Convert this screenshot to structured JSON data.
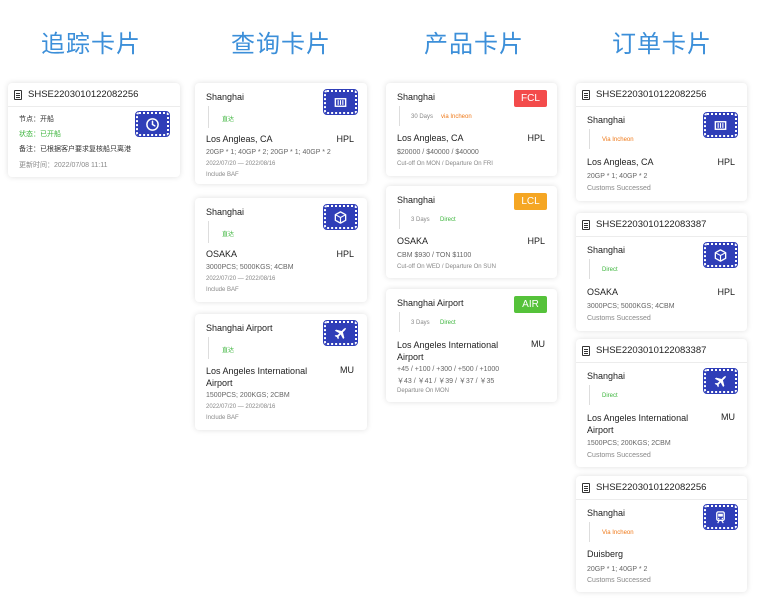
{
  "columns": {
    "tracking": "追踪卡片",
    "query": "查询卡片",
    "product": "产品卡片",
    "order": "订单卡片"
  },
  "colors": {
    "title_blue": "#3c8fd9",
    "stamp_blue": "#2f3eb8",
    "status_green": "#3cb53c",
    "via_orange": "#ef7a1a",
    "fcl_red": "#f34b4b",
    "lcl_orange": "#f5a623",
    "air_green": "#55c23a"
  },
  "tracking_card": {
    "order_no": "SHSE2203010122082256",
    "node": "节点：开船",
    "status": "状态：已开船",
    "remark": "备注：已根据客户要求复核船只离港",
    "updated": "更新时间：2022/07/08 11:11",
    "icon": "clock-icon"
  },
  "query_cards": [
    {
      "origin": "Shanghai",
      "route": "直达",
      "dest": "Los Angleas, CA",
      "carrier": "HPL",
      "spec": "20GP * 1; 40GP * 2; 20GP * 1; 40GP * 2",
      "dates": "2022/07/20 — 2022/08/16",
      "note": "Include BAF",
      "icon": "container-icon"
    },
    {
      "origin": "Shanghai",
      "route": "直达",
      "dest": "OSAKA",
      "carrier": "HPL",
      "spec": "3000PCS; 5000KGS; 4CBM",
      "dates": "2022/07/20 — 2022/08/16",
      "note": "Include BAF",
      "icon": "box-icon"
    },
    {
      "origin": "Shanghai Airport",
      "route": "直达",
      "dest": "Los Angeles International Airport",
      "carrier": "MU",
      "spec": "1500PCS; 200KGS; 2CBM",
      "dates": "2022/07/20 — 2022/08/16",
      "note": "Include BAF",
      "icon": "plane-icon"
    }
  ],
  "product_cards": [
    {
      "origin": "Shanghai",
      "days": "30 Days",
      "route": "via Incheon",
      "dest": "Los Angleas, CA",
      "carrier": "HPL",
      "price": "$20000 / $40000 / $40000",
      "schedule": "Cut-off On MON / Departure On FRI",
      "tag": "FCL"
    },
    {
      "origin": "Shanghai",
      "days": "3 Days",
      "route": "Direct",
      "dest": "OSAKA",
      "carrier": "HPL",
      "price": "CBM $930 / TON $1100",
      "schedule": "Cut-off On WED / Departure On SUN",
      "tag": "LCL"
    },
    {
      "origin": "Shanghai Airport",
      "days": "3 Days",
      "route": "Direct",
      "dest": "Los Angeles International Airport",
      "carrier": "MU",
      "price_line1": "+45 / +100 / +300 / +500 / +1000",
      "price_line2": "￥43 / ￥41 / ￥39 / ￥37 / ￥35",
      "schedule": "Departure On MON",
      "tag": "AIR"
    }
  ],
  "order_cards": [
    {
      "order_no": "SHSE2203010122082256",
      "origin": "Shanghai",
      "route": "Via Incheon",
      "dest": "Los Angleas, CA",
      "carrier": "HPL",
      "spec": "20GP * 1; 40GP * 2",
      "status": "Customs Successed",
      "icon": "container-icon"
    },
    {
      "order_no": "SHSE2203010122083387",
      "origin": "Shanghai",
      "route": "Direct",
      "dest": "OSAKA",
      "carrier": "HPL",
      "spec": "3000PCS; 5000KGS; 4CBM",
      "status": "Customs Successed",
      "icon": "box-icon"
    },
    {
      "order_no": "SHSE2203010122083387",
      "origin": "Shanghai",
      "route": "Direct",
      "dest": "Los Angeles International Airport",
      "carrier": "MU",
      "spec": "1500PCS; 200KGS; 2CBM",
      "status": "Customs Successed",
      "icon": "plane-icon"
    },
    {
      "order_no": "SHSE2203010122082256",
      "origin": "Shanghai",
      "route": "Via Incheon",
      "dest": "Duisberg",
      "carrier": "",
      "spec": "20GP * 1; 40GP * 2",
      "status": "Customs Successed",
      "icon": "train-icon"
    }
  ]
}
